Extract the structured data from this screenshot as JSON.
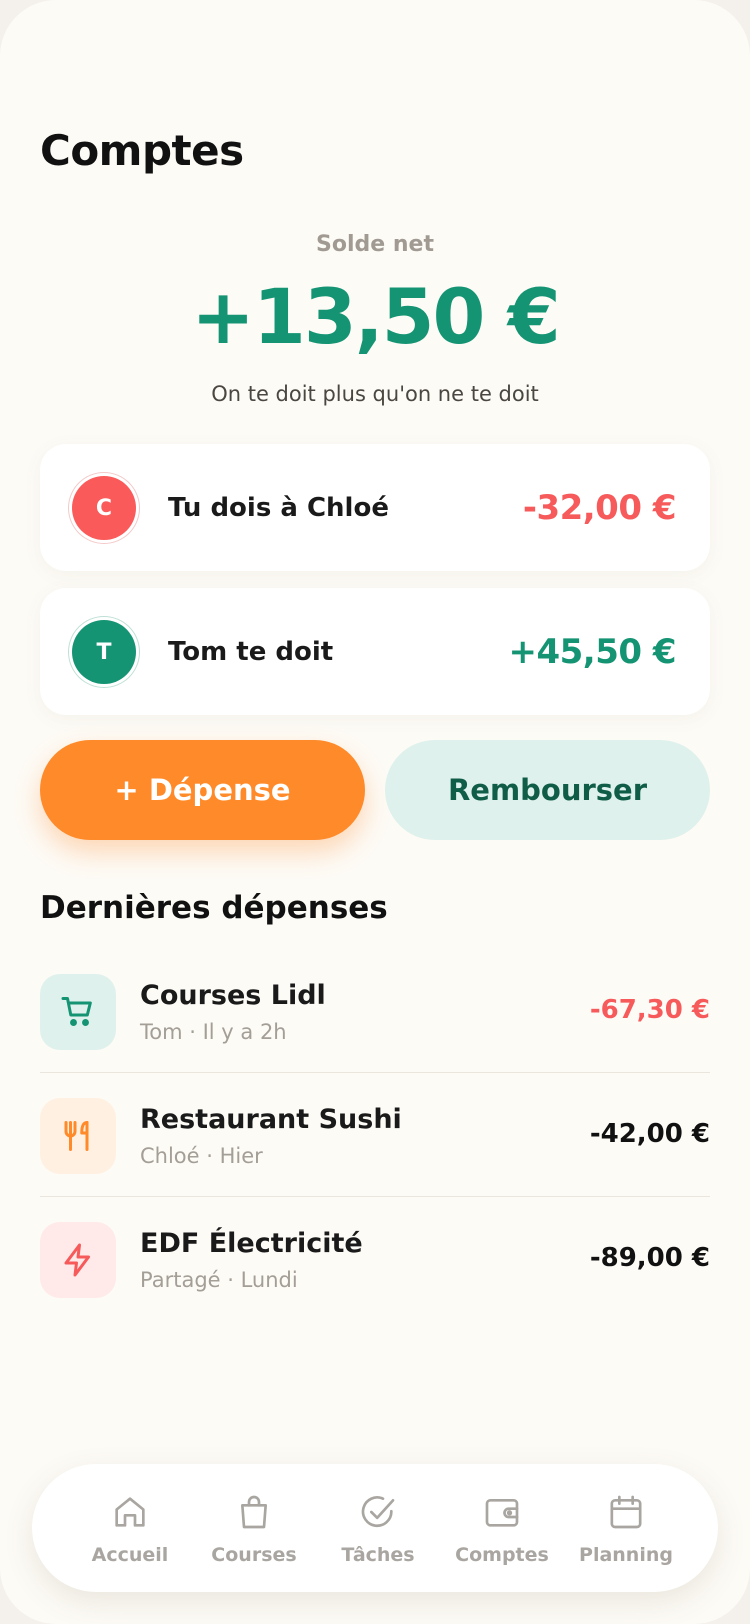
{
  "header": {
    "title": "Comptes"
  },
  "balance": {
    "label": "Solde net",
    "amount": "+13,50 €",
    "caption": "On te doit plus qu'on ne te doit"
  },
  "debts": [
    {
      "initial": "C",
      "text": "Tu dois à Chloé",
      "amount": "-32,00 €",
      "color": "#fa5a59"
    },
    {
      "initial": "T",
      "text": "Tom te doit",
      "amount": "+45,50 €",
      "color": "#159474"
    }
  ],
  "actions": {
    "expense_label": "+ Dépense",
    "repay_label": "Rembourser"
  },
  "recent": {
    "title": "Dernières dépenses",
    "items": [
      {
        "icon": "cart-icon",
        "name": "Courses Lidl",
        "meta": "Tom · Il y a 2h",
        "amount": "-67,30 €"
      },
      {
        "icon": "fork-knife-icon",
        "name": "Restaurant Sushi",
        "meta": "Chloé · Hier",
        "amount": "-42,00 €"
      },
      {
        "icon": "bolt-icon",
        "name": "EDF Électricité",
        "meta": "Partagé · Lundi",
        "amount": "-89,00 €"
      }
    ]
  },
  "tabbar": {
    "items": [
      {
        "icon": "home-icon",
        "label": "Accueil"
      },
      {
        "icon": "shopping-bag-icon",
        "label": "Courses"
      },
      {
        "icon": "check-circle-icon",
        "label": "Tâches"
      },
      {
        "icon": "wallet-icon",
        "label": "Comptes"
      },
      {
        "icon": "calendar-icon",
        "label": "Planning"
      }
    ]
  },
  "colors": {
    "accent_green": "#159474",
    "accent_orange": "#ff8a2a",
    "negative_red": "#f65a5a",
    "background": "#fdfbf6"
  }
}
